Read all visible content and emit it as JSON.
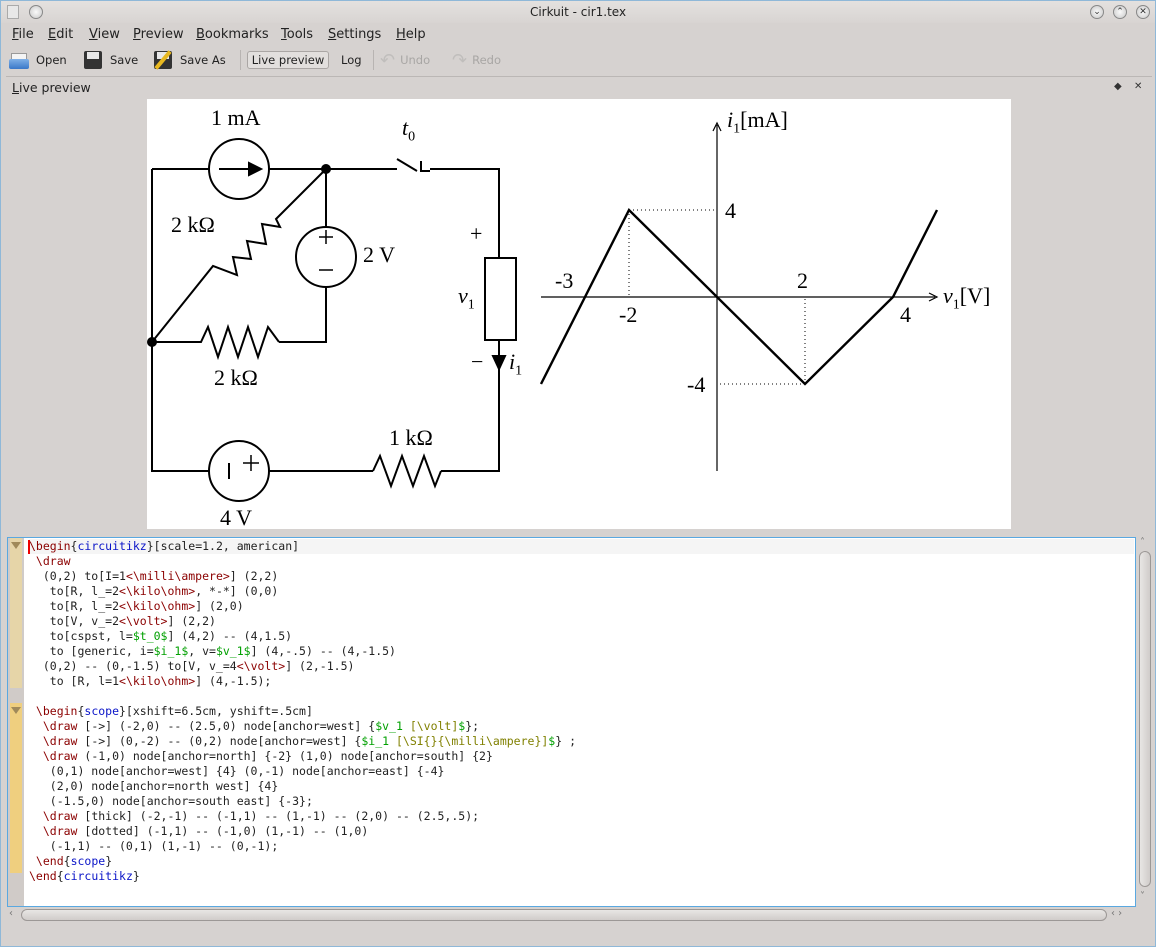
{
  "window": {
    "title": "Cirkuit - cir1.tex"
  },
  "menu": [
    "File",
    "Edit",
    "View",
    "Preview",
    "Bookmarks",
    "Tools",
    "Settings",
    "Help"
  ],
  "toolbar": {
    "open": "Open",
    "save": "Save",
    "save_as": "Save As",
    "live_preview": "Live preview",
    "log": "Log",
    "undo": "Undo",
    "redo": "Redo"
  },
  "dock": {
    "title": "Live preview"
  },
  "circuit": {
    "current_source": "1 mA",
    "switch": "t",
    "switch_sub": "0",
    "res_diag": "2 kΩ",
    "vsource": "2 V",
    "res_mid": "2 kΩ",
    "res_bottom": "1 kΩ",
    "vsource_bottom": "4 V",
    "plus": "+",
    "minus": "−",
    "v": "v",
    "v_sub": "1",
    "i": "i",
    "i_sub": "1"
  },
  "chart_data": {
    "type": "line",
    "xlabel": "v1 [V]",
    "ylabel": "i1 [mA]",
    "xlabel_parts": {
      "sym": "v",
      "sub": "1",
      "unit": "[V]"
    },
    "ylabel_parts": {
      "sym": "i",
      "sub": "1",
      "unit": "[mA]"
    },
    "x_tick_labels": [
      "-3",
      "-2",
      "2",
      "4"
    ],
    "x_ticks": [
      -3,
      -2,
      2,
      4
    ],
    "y_tick_labels": [
      "4",
      "-4"
    ],
    "y_ticks": [
      4,
      -4
    ],
    "xlim": [
      -4,
      5
    ],
    "ylim": [
      -8,
      8
    ],
    "series": [
      {
        "x": [
          -4,
          -2,
          2,
          4,
          5
        ],
        "y": [
          -4,
          4,
          -4,
          0,
          4
        ]
      }
    ],
    "guides": [
      [
        [
          -2,
          4
        ],
        [
          -2,
          0
        ]
      ],
      [
        [
          2,
          -4
        ],
        [
          2,
          0
        ]
      ],
      [
        [
          -2,
          4
        ],
        [
          0,
          4
        ]
      ],
      [
        [
          2,
          -4
        ],
        [
          0,
          -4
        ]
      ]
    ],
    "grid": false
  },
  "editor": {
    "lines": [
      [
        [
          "\\begin",
          "kw"
        ],
        [
          "{",
          "n"
        ],
        [
          "circuitikz",
          "env"
        ],
        [
          "}[scale=1.2, american]",
          "n"
        ]
      ],
      [
        [
          " \\draw",
          "kw"
        ]
      ],
      [
        [
          "  (0,2) to[I=1",
          "n"
        ],
        [
          "<\\milli\\ampere>",
          "kw"
        ],
        [
          "] (2,2)",
          "n"
        ]
      ],
      [
        [
          "   to[R, l_=2",
          "n"
        ],
        [
          "<\\kilo\\ohm>",
          "kw"
        ],
        [
          ", *-*] (0,0)",
          "n"
        ]
      ],
      [
        [
          "   to[R, l_=2",
          "n"
        ],
        [
          "<\\kilo\\ohm>",
          "kw"
        ],
        [
          "] (2,0)",
          "n"
        ]
      ],
      [
        [
          "   to[V, v_=2",
          "n"
        ],
        [
          "<\\volt>",
          "kw"
        ],
        [
          "] (2,2)",
          "n"
        ]
      ],
      [
        [
          "   to[cspst, l=",
          "n"
        ],
        [
          "$t_0$",
          "math"
        ],
        [
          "] (4,2) -- (4,1.5)",
          "n"
        ]
      ],
      [
        [
          "   to [generic, i=",
          "n"
        ],
        [
          "$i_1$",
          "math"
        ],
        [
          ", v=",
          "n"
        ],
        [
          "$v_1$",
          "math"
        ],
        [
          "] (4,-.5) -- (4,-1.5)",
          "n"
        ]
      ],
      [
        [
          "  (0,2) -- (0,-1.5) to[V, v_=4",
          "n"
        ],
        [
          "<\\volt>",
          "kw"
        ],
        [
          "] (2,-1.5)",
          "n"
        ]
      ],
      [
        [
          "   to [R, l=1",
          "n"
        ],
        [
          "<\\kilo\\ohm>",
          "kw"
        ],
        [
          "] (4,-1.5);",
          "n"
        ]
      ],
      [],
      [
        [
          " \\begin",
          "kw"
        ],
        [
          "{",
          "n"
        ],
        [
          "scope",
          "env"
        ],
        [
          "}[xshift=6.5cm, yshift=.5cm]",
          "n"
        ]
      ],
      [
        [
          "  \\draw",
          "kw"
        ],
        [
          " [->] (-2,0) -- (2.5,0) node[anchor=west] {",
          "n"
        ],
        [
          "$v_1 ",
          "math"
        ],
        [
          "[\\volt]",
          "olive"
        ],
        [
          "$",
          "math"
        ],
        [
          "};",
          "n"
        ]
      ],
      [
        [
          "  \\draw",
          "kw"
        ],
        [
          " [->] (0,-2) -- (0,2) node[anchor=west] {",
          "n"
        ],
        [
          "$i_1 ",
          "math"
        ],
        [
          "[\\SI{}{\\milli\\ampere}]",
          "olive"
        ],
        [
          "$",
          "math"
        ],
        [
          "} ;",
          "n"
        ]
      ],
      [
        [
          "  \\draw",
          "kw"
        ],
        [
          " (-1,0) node[anchor=north] {-2} (1,0) node[anchor=south] {2}",
          "n"
        ]
      ],
      [
        [
          "   (0,1) node[anchor=west] {4} (0,-1) node[anchor=east] {-4}",
          "n"
        ]
      ],
      [
        [
          "   (2,0) node[anchor=north west] {4}",
          "n"
        ]
      ],
      [
        [
          "   (-1.5,0) node[anchor=south east] {-3};",
          "n"
        ]
      ],
      [
        [
          "  \\draw",
          "kw"
        ],
        [
          " [thick] (-2,-1) -- (-1,1) -- (1,-1) -- (2,0) -- (2.5,.5);",
          "n"
        ]
      ],
      [
        [
          "  \\draw",
          "kw"
        ],
        [
          " [dotted] (-1,1) -- (-1,0) (1,-1) -- (1,0)",
          "n"
        ]
      ],
      [
        [
          "   (-1,1) -- (0,1) (1,-1) -- (0,-1);",
          "n"
        ]
      ],
      [
        [
          " \\end",
          "kw"
        ],
        [
          "{",
          "n"
        ],
        [
          "scope",
          "env"
        ],
        [
          "}",
          "n"
        ]
      ],
      [
        [
          "\\end",
          "kw"
        ],
        [
          "{",
          "n"
        ],
        [
          "circuitikz",
          "env"
        ],
        [
          "}",
          "n"
        ]
      ]
    ]
  }
}
